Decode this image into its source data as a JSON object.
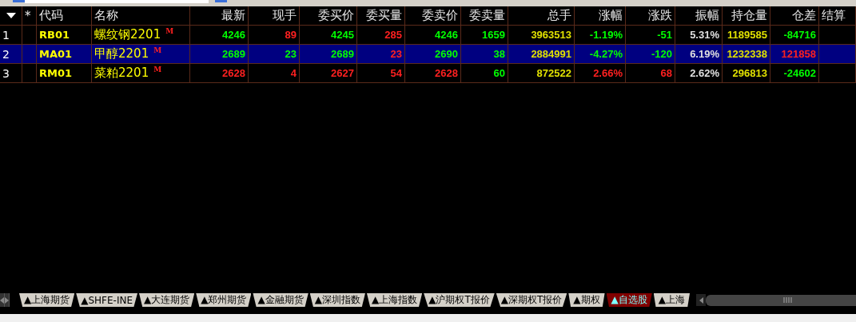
{
  "table": {
    "columns": [
      "*",
      "代码",
      "名称",
      "最新",
      "现手",
      "委买价",
      "委买量",
      "委卖价",
      "委卖量",
      "总手",
      "涨幅",
      "涨跌",
      "振幅",
      "持仓量",
      "仓差",
      "结算"
    ],
    "rows": [
      {
        "index": "1",
        "selected": false,
        "cells": [
          {
            "text": ""
          },
          {
            "text": "RB01",
            "color": "#ffff00"
          },
          {
            "text": "螺纹钢2201",
            "mark": "M",
            "color": "#ffff00"
          },
          {
            "text": "4246",
            "color": "#00ff00"
          },
          {
            "text": "89",
            "color": "#ff2020"
          },
          {
            "text": "4245",
            "color": "#00ff00"
          },
          {
            "text": "285",
            "color": "#ff2020"
          },
          {
            "text": "4246",
            "color": "#00ff00"
          },
          {
            "text": "1659",
            "color": "#00ff00"
          },
          {
            "text": "3963513",
            "color": "#e0e000"
          },
          {
            "text": "-1.19%",
            "color": "#00ff00"
          },
          {
            "text": "-51",
            "color": "#00ff00"
          },
          {
            "text": "5.31%",
            "color": "#e0e0e0"
          },
          {
            "text": "1189585",
            "color": "#e0e000"
          },
          {
            "text": "-84716",
            "color": "#00ff00"
          }
        ]
      },
      {
        "index": "2",
        "selected": true,
        "cells": [
          {
            "text": ""
          },
          {
            "text": "MA01",
            "color": "#ffff00"
          },
          {
            "text": "甲醇2201",
            "mark": "M",
            "color": "#ffff00"
          },
          {
            "text": "2689",
            "color": "#00ff00"
          },
          {
            "text": "23",
            "color": "#00ff00"
          },
          {
            "text": "2689",
            "color": "#00ff00"
          },
          {
            "text": "23",
            "color": "#ff2020"
          },
          {
            "text": "2690",
            "color": "#00ff00"
          },
          {
            "text": "38",
            "color": "#00ff00"
          },
          {
            "text": "2884991",
            "color": "#e0e000"
          },
          {
            "text": "-4.27%",
            "color": "#00ff00"
          },
          {
            "text": "-120",
            "color": "#00ff00"
          },
          {
            "text": "6.19%",
            "color": "#e0e0e0"
          },
          {
            "text": "1232338",
            "color": "#e0e000"
          },
          {
            "text": "121858",
            "color": "#ff2020"
          }
        ]
      },
      {
        "index": "3",
        "selected": false,
        "cells": [
          {
            "text": ""
          },
          {
            "text": "RM01",
            "color": "#ffff00"
          },
          {
            "text": "菜粕2201",
            "mark": "M",
            "color": "#ffff00"
          },
          {
            "text": "2628",
            "color": "#ff2020"
          },
          {
            "text": "4",
            "color": "#ff2020"
          },
          {
            "text": "2627",
            "color": "#ff2020"
          },
          {
            "text": "54",
            "color": "#ff2020"
          },
          {
            "text": "2628",
            "color": "#ff2020"
          },
          {
            "text": "60",
            "color": "#00ff00"
          },
          {
            "text": "872522",
            "color": "#e0e000"
          },
          {
            "text": "2.66%",
            "color": "#ff2020"
          },
          {
            "text": "68",
            "color": "#ff2020"
          },
          {
            "text": "2.62%",
            "color": "#e0e0e0"
          },
          {
            "text": "296813",
            "color": "#e0e000"
          },
          {
            "text": "-24602",
            "color": "#00ff00"
          }
        ]
      }
    ]
  },
  "tabs": [
    {
      "label": "▲上海期货",
      "selected": false
    },
    {
      "label": "▲SHFE-INE",
      "selected": false
    },
    {
      "label": "▲大连期货",
      "selected": false
    },
    {
      "label": "▲郑州期货",
      "selected": false
    },
    {
      "label": "▲金融期货",
      "selected": false
    },
    {
      "label": "▲深圳指数",
      "selected": false
    },
    {
      "label": "▲上海指数",
      "selected": false
    },
    {
      "label": "▲沪期权T报价",
      "selected": false
    },
    {
      "label": "▲深期权T报价",
      "selected": false
    },
    {
      "label": "▲期权",
      "selected": false
    },
    {
      "label": "▲自选股",
      "selected": true
    },
    {
      "label": "▲上海",
      "selected": false
    }
  ]
}
